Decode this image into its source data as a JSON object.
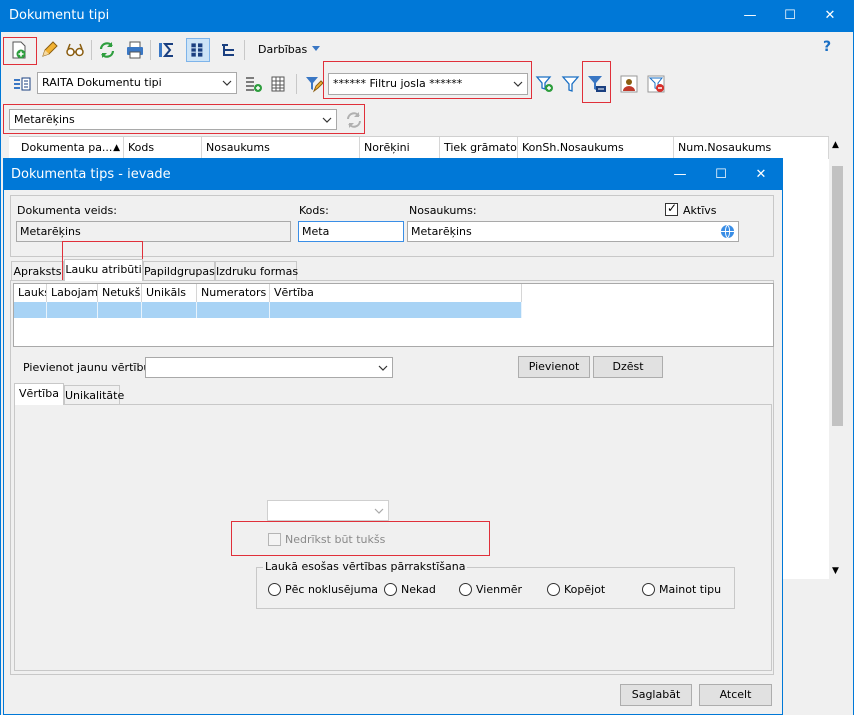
{
  "main_window": {
    "title": "Dokumentu tipi",
    "controls": {
      "minimize": "—",
      "maximize": "☐",
      "close": "✕"
    }
  },
  "toolbar": {
    "darbibas_label": "Darbības",
    "help": "?"
  },
  "filter_toolbar": {
    "dataset_combo": "RAITA Dokumentu tipi",
    "filter_combo": "****** Filtru josla ******"
  },
  "doc_type_combo": "Metarēķins",
  "grid": {
    "columns": [
      "Dokumenta pa...",
      "Kods",
      "Nosaukums",
      "Norēķini",
      "Tiek grāmatots",
      "KonSh.Nosaukums",
      "Num.Nosaukums"
    ],
    "sort_indicator": "▲"
  },
  "dialog": {
    "title": "Dokumenta tips - ievade",
    "controls": {
      "minimize": "—",
      "maximize": "☐",
      "close": "✕"
    },
    "labels": {
      "doc_kind": "Dokumenta veids:",
      "code": "Kods:",
      "name": "Nosaukums:",
      "active": "Aktīvs"
    },
    "values": {
      "doc_kind": "Metarēķins",
      "code": "Meta",
      "name": "Metarēķins",
      "active_check": "✓"
    },
    "tabs": [
      "Apraksts",
      "Lauku atribūti",
      "Papildgrupas",
      "Izdruku formas"
    ],
    "inner_grid_columns": [
      "Lauks",
      "Labojams",
      "Netukšs",
      "Unikāls",
      "Numerators",
      "Vērtība"
    ],
    "add_value_label": "Pievienot jaunu vērtību:",
    "add_button": "Pievienot",
    "delete_button": "Dzēst",
    "subtabs": [
      "Vērtība",
      "Unikalitāte"
    ],
    "not_empty_label": "Nedrīkst būt tukšs",
    "overwrite_group_title": "Laukā esošas vērtības pārrakstīšana",
    "overwrite_options": [
      "Pēc noklusējuma",
      "Nekad",
      "Vienmēr",
      "Kopējot",
      "Mainot tipu"
    ],
    "save_button": "Saglabāt",
    "cancel_button": "Atcelt"
  },
  "colors": {
    "titlebar": "#0078d7",
    "highlight": "#e0303a",
    "selection": "#a8d3f5"
  }
}
